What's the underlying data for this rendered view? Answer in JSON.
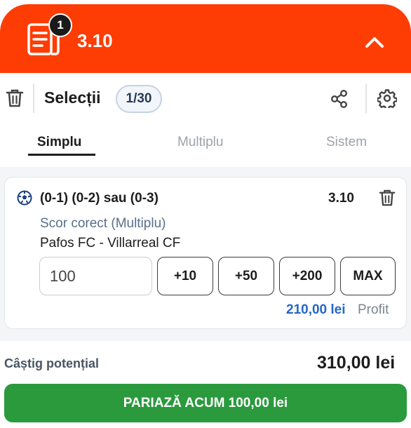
{
  "header": {
    "badge_count": "1",
    "total_odds": "3.10"
  },
  "toolbar": {
    "title": "Selecții",
    "selection_count": "1/30"
  },
  "tabs": [
    {
      "label": "Simplu",
      "active": true
    },
    {
      "label": "Multiplu",
      "active": false
    },
    {
      "label": "Sistem",
      "active": false
    }
  ],
  "selection": {
    "name": "(0-1) (0-2) sau (0-3)",
    "odds": "3.10",
    "market": "Scor corect (Multiplu)",
    "event": "Pafos FC - Villarreal CF",
    "stake": "100",
    "quick_stakes": [
      "+10",
      "+50",
      "+200",
      "MAX"
    ],
    "profit_value": "210,00 lei",
    "profit_label": "Profit"
  },
  "footer": {
    "potential_label": "Câștig potențial",
    "potential_value": "310,00 lei",
    "bet_button": "PARIAZĂ ACUM 100,00 lei"
  },
  "colors": {
    "header_bg": "#fe3d04",
    "bet_button_bg": "#2a9a3d",
    "profit_text": "#2666c8"
  }
}
